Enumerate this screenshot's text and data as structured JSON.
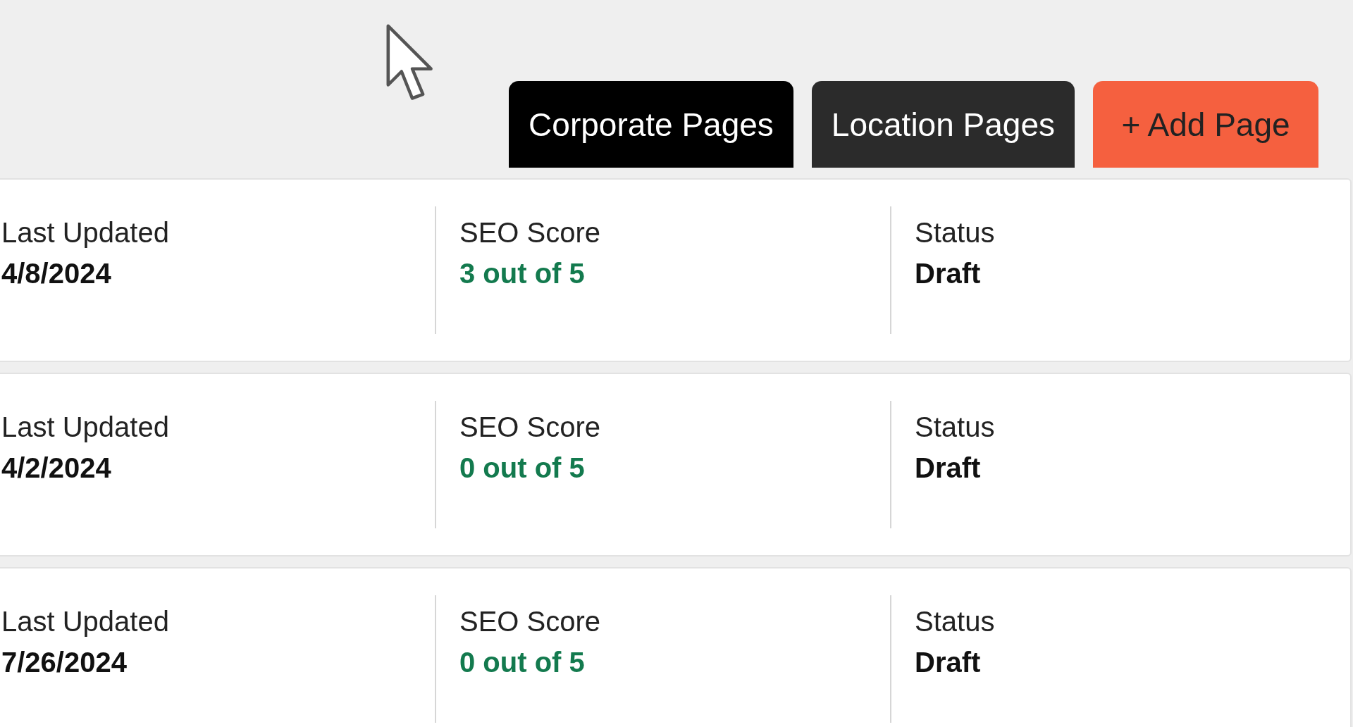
{
  "tabs": [
    {
      "label": "Corporate Pages",
      "selected": true
    },
    {
      "label": "Location Pages",
      "selected": false
    }
  ],
  "add_button": {
    "label": "+ Add Page"
  },
  "pages": [
    {
      "last_updated_label": "Last Updated",
      "last_updated": "4/8/2024",
      "seo_label": "SEO Score",
      "seo_score": "3 out of 5",
      "status_label": "Status",
      "status": "Draft"
    },
    {
      "last_updated_label": "Last Updated",
      "last_updated": "4/2/2024",
      "seo_label": "SEO Score",
      "seo_score": "0 out of 5",
      "status_label": "Status",
      "status": "Draft"
    },
    {
      "last_updated_label": "Last Updated",
      "last_updated": "7/26/2024",
      "seo_label": "SEO Score",
      "seo_score": "0 out of 5",
      "status_label": "Status",
      "status": "Draft"
    }
  ]
}
